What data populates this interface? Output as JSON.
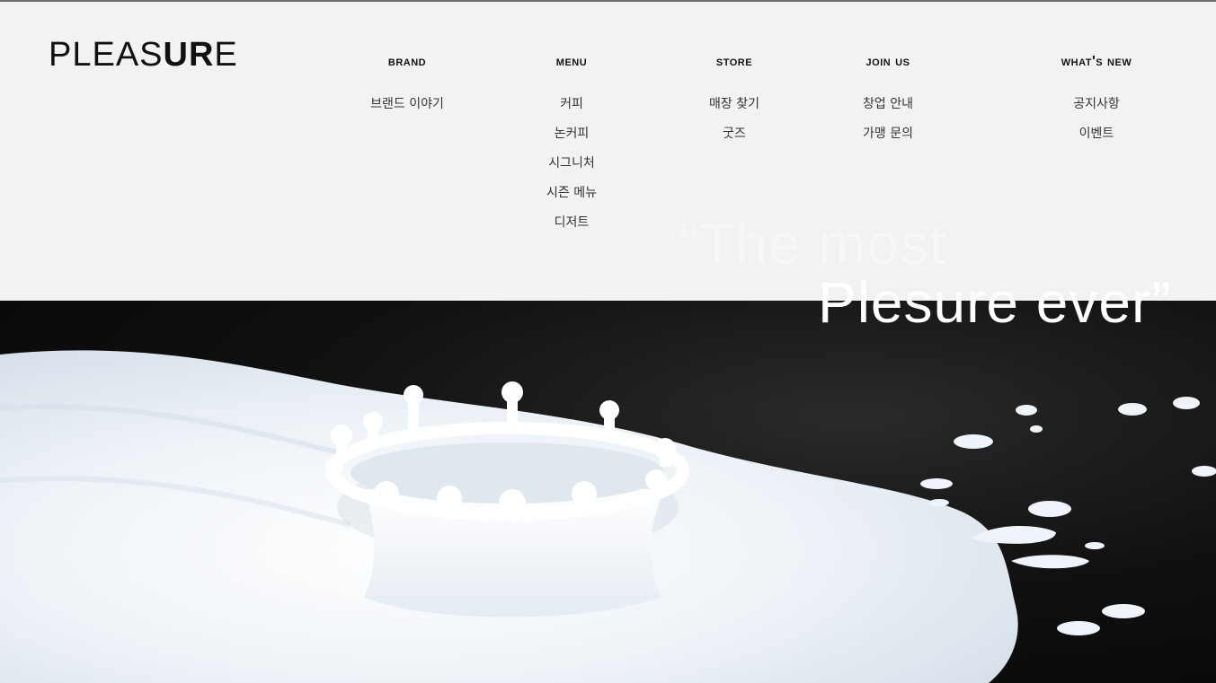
{
  "header": {
    "logo": {
      "light": "PLEAS",
      "bold": "UR",
      "light2": "E"
    },
    "nav": [
      {
        "title": "Brand",
        "items": [
          "브랜드 이야기"
        ]
      },
      {
        "title": "Menu",
        "items": [
          "커피",
          "논커피",
          "시그니처",
          "시즌 메뉴",
          "디저트"
        ]
      },
      {
        "title": "store",
        "items": [
          "매장 찾기",
          "굿즈"
        ]
      },
      {
        "title": "Join us",
        "items": [
          "창업 안내",
          "가맹 문의"
        ]
      },
      {
        "title": "What's New",
        "items": [
          "공지사항",
          "이벤트"
        ]
      }
    ]
  },
  "hero": {
    "quote_line1": "“The  most",
    "quote_line2": "Plesure ever”"
  },
  "colors": {
    "header_bg": "#f2f2f2",
    "hero_bg": "#0a0a0a",
    "milk": "#eef3f8",
    "text_dark": "#111111"
  }
}
